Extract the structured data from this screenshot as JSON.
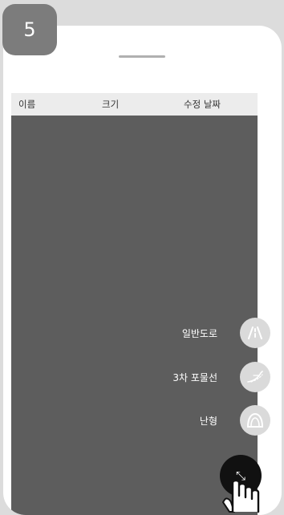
{
  "step": {
    "number": "5"
  },
  "file_list": {
    "columns": {
      "name": "이름",
      "size": "크기",
      "modified": "수정 날짜"
    }
  },
  "fab_menu": {
    "items": [
      {
        "label": "일반도로",
        "icon": "general-road-icon"
      },
      {
        "label": "3차 포물선",
        "icon": "cubic-parabola-icon"
      },
      {
        "label": "난형",
        "icon": "oval-icon"
      }
    ],
    "close_button": {
      "icon": "collapse-icon",
      "glyph": "⤡"
    }
  },
  "colors": {
    "overlay": "#5d5d5d",
    "fab_background": "#111111",
    "menu_icon_background": "#dadada",
    "badge_background": "#7c7c7c"
  }
}
